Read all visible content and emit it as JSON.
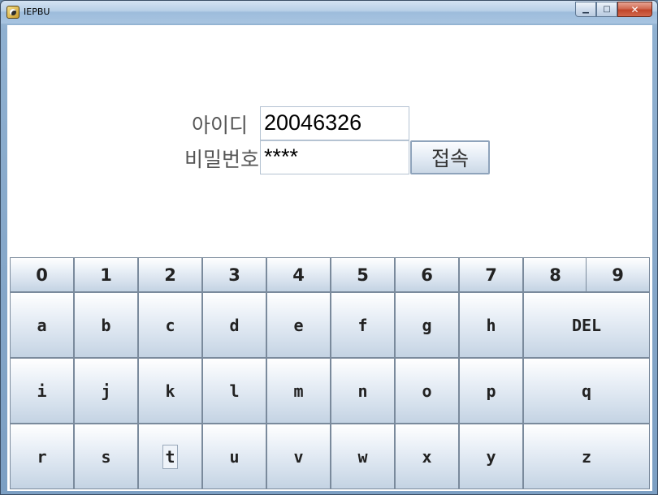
{
  "window": {
    "title": "IEPBU",
    "minimize": "▁",
    "maximize": "□",
    "close": "✕"
  },
  "login": {
    "id_label": "아이디",
    "id_value": "20046326",
    "password_label": "비밀번호",
    "password_value": "****",
    "connect_label": "접속"
  },
  "keypad": {
    "numbers": [
      "0",
      "1",
      "2",
      "3",
      "4",
      "5",
      "6",
      "7",
      "8",
      "9"
    ],
    "row1": [
      "a",
      "b",
      "c",
      "d",
      "e",
      "f",
      "g",
      "h"
    ],
    "row1_wide": "DEL",
    "row2": [
      "i",
      "j",
      "k",
      "l",
      "m",
      "n",
      "o",
      "p"
    ],
    "row2_wide": "q",
    "row3": [
      "r",
      "s",
      "t",
      "u",
      "v",
      "w",
      "x",
      "y"
    ],
    "row3_wide": "z",
    "focused_key": "t"
  }
}
